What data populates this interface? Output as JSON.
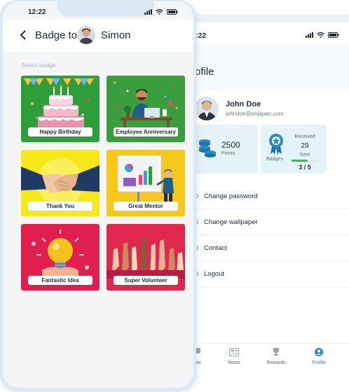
{
  "front": {
    "status_time": "12:22",
    "header": {
      "title": "Badge to",
      "recipient": "Simon"
    },
    "select_label": "Select badge",
    "badges": [
      {
        "label": "Happy Birthday"
      },
      {
        "label": "Employee Anniversary"
      },
      {
        "label": "Thank You"
      },
      {
        "label": "Great Mentor"
      },
      {
        "label": "Fantastic Idea"
      },
      {
        "label": "Super Volunteer"
      }
    ]
  },
  "back": {
    "status_time": "2:22",
    "title": "ofile",
    "user": {
      "name": "John Doe",
      "email": "johndoe@enjapan.com"
    },
    "points": {
      "value": "2500",
      "label": "Points"
    },
    "badges": {
      "label": "Badges",
      "received_label": "Received",
      "received_value": "29",
      "sent_label": "Sent",
      "sent_value": "3 / 5",
      "sent_fraction": 0.6
    },
    "menu": [
      "Change password",
      "Change wallpaper",
      "Contact",
      "Logout"
    ],
    "tabs": [
      "ats",
      "News",
      "Rewards",
      "Profile"
    ]
  },
  "colors": {
    "accent": "#2b8bc6",
    "card_bg": "#e4f3f8",
    "sent_bar": "#4caf50"
  }
}
